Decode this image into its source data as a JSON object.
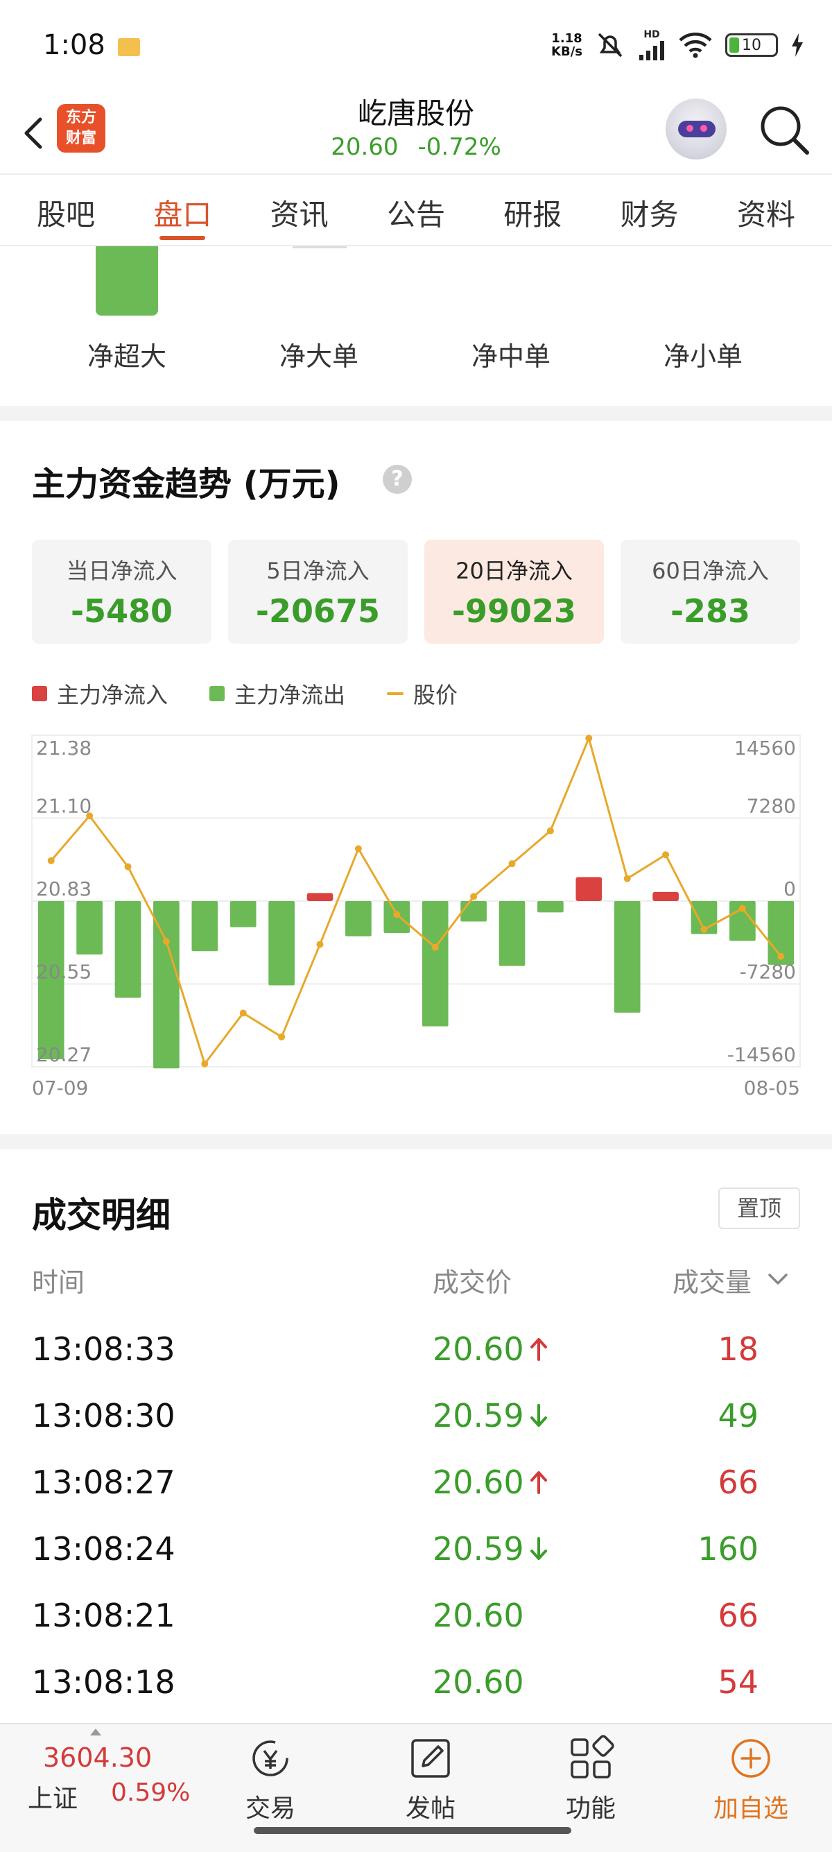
{
  "status_bar": {
    "time": "1:08",
    "net_speed_top": "1.18",
    "net_speed_unit": "KB/s",
    "signal_label": "HD",
    "battery": "10"
  },
  "header": {
    "logo_line1": "东方",
    "logo_line2": "财富",
    "stock_name": "屹唐股份",
    "price": "20.60",
    "change_pct": "-0.72%"
  },
  "tabs": [
    {
      "label": "股吧",
      "active": false
    },
    {
      "label": "盘口",
      "active": true
    },
    {
      "label": "资讯",
      "active": false
    },
    {
      "label": "公告",
      "active": false
    },
    {
      "label": "研报",
      "active": false
    },
    {
      "label": "财务",
      "active": false
    },
    {
      "label": "资料",
      "active": false
    }
  ],
  "net_order_labels": [
    "净超大",
    "净大单",
    "净中单",
    "净小单"
  ],
  "capital_trend": {
    "title": "主力资金趋势 (万元)",
    "help": "?",
    "cards": [
      {
        "label": "当日净流入",
        "value": "-5480",
        "active": false
      },
      {
        "label": "5日净流入",
        "value": "-20675",
        "active": false
      },
      {
        "label": "20日净流入",
        "value": "-99023",
        "active": true
      },
      {
        "label": "60日净流入",
        "value": "-283",
        "active": false
      }
    ],
    "legend": [
      {
        "label": "主力净流入",
        "color": "#d9423f",
        "kind": "square"
      },
      {
        "label": "主力净流出",
        "color": "#6bba55",
        "kind": "square"
      },
      {
        "label": "股价",
        "color": "#e8a82a",
        "kind": "line"
      }
    ]
  },
  "chart_data": {
    "type": "bar",
    "x_start_label": "07-09",
    "x_end_label": "08-05",
    "left_axis_ticks": [
      "21.38",
      "21.10",
      "20.83",
      "20.55",
      "20.27"
    ],
    "right_axis_ticks": [
      "14560",
      "7280",
      "0",
      "-7280",
      "-14560"
    ],
    "left_axis_range": [
      20.27,
      21.38
    ],
    "right_axis_range": [
      -14560,
      14560
    ],
    "series": [
      {
        "name": "主力净流入/净流出",
        "values": [
          -13900,
          -4700,
          -8500,
          -14700,
          -4400,
          -2300,
          -7400,
          700,
          -3100,
          -2800,
          -11000,
          -1800,
          -5700,
          -1000,
          2100,
          -9800,
          800,
          -2900,
          -3500,
          -5600
        ]
      },
      {
        "name": "股价",
        "values": [
          20.96,
          21.11,
          20.94,
          20.69,
          20.28,
          20.45,
          20.37,
          20.68,
          21.0,
          20.78,
          20.67,
          20.84,
          20.95,
          21.06,
          21.37,
          20.9,
          20.98,
          20.73,
          20.8,
          20.64
        ]
      }
    ]
  },
  "trade_detail": {
    "title": "成交明细",
    "pin_button": "置顶",
    "headers": {
      "time": "时间",
      "price": "成交价",
      "volume": "成交量"
    },
    "rows": [
      {
        "time": "13:08:33",
        "price": "20.60",
        "arrow": "up",
        "volume": "18",
        "vol_dir": "up"
      },
      {
        "time": "13:08:30",
        "price": "20.59",
        "arrow": "down",
        "volume": "49",
        "vol_dir": "down"
      },
      {
        "time": "13:08:27",
        "price": "20.60",
        "arrow": "up",
        "volume": "66",
        "vol_dir": "up"
      },
      {
        "time": "13:08:24",
        "price": "20.59",
        "arrow": "down",
        "volume": "160",
        "vol_dir": "down"
      },
      {
        "time": "13:08:21",
        "price": "20.60",
        "arrow": "none",
        "volume": "66",
        "vol_dir": "up"
      },
      {
        "time": "13:08:18",
        "price": "20.60",
        "arrow": "none",
        "volume": "54",
        "vol_dir": "up"
      }
    ]
  },
  "bottom_bar": {
    "index_value": "3604.30",
    "index_name": "上证",
    "index_pct": "0.59%",
    "items": [
      {
        "label": "交易",
        "icon": "trade-yen-icon"
      },
      {
        "label": "发帖",
        "icon": "compose-post-icon"
      },
      {
        "label": "功能",
        "icon": "functions-grid-icon"
      },
      {
        "label": "加自选",
        "icon": "add-watchlist-icon"
      }
    ]
  }
}
